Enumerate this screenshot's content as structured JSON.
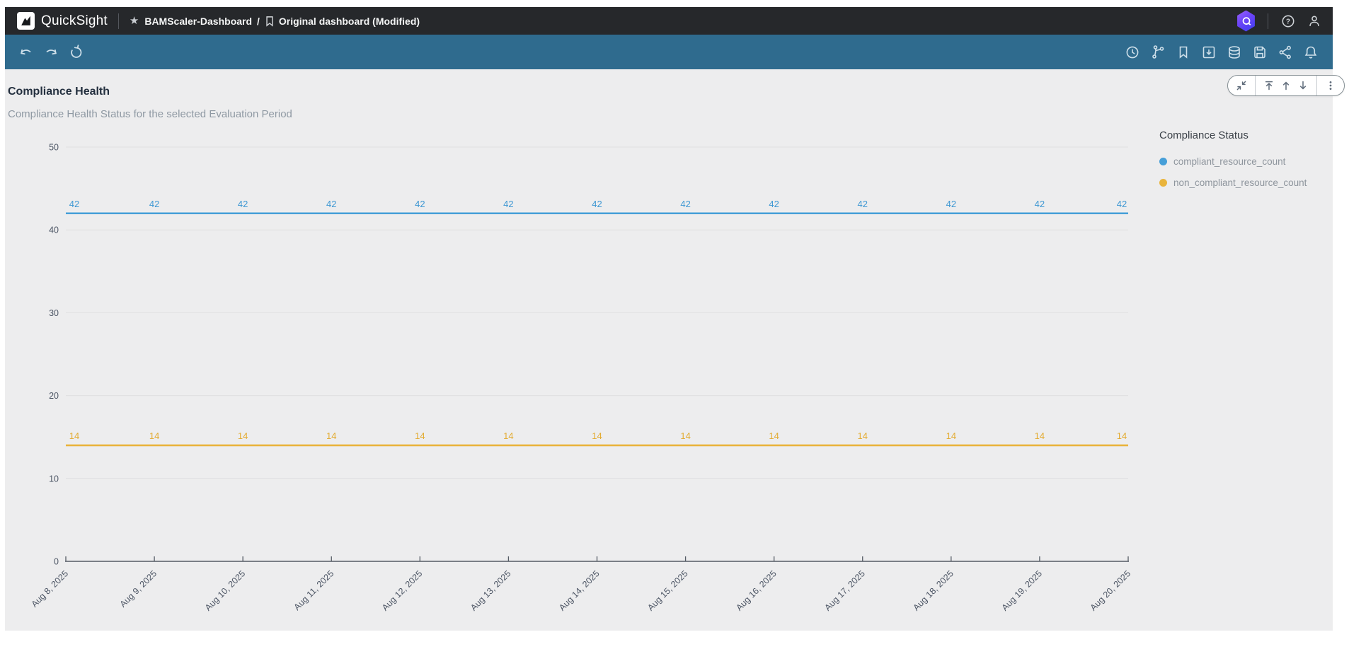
{
  "topbar": {
    "app_name": "QuickSight",
    "breadcrumb": {
      "dashboard": "BAMScaler-Dashboard",
      "separator": "/",
      "page": "Original dashboard (Modified)"
    }
  },
  "widget": {
    "title": "Compliance Health",
    "subtitle": "Compliance Health Status for the selected Evaluation Period"
  },
  "legend": {
    "title": "Compliance Status"
  },
  "colors": {
    "topbar_bg": "#26282b",
    "toolbar_bg": "#2f6b8e",
    "content_bg": "#ededee",
    "grid_line": "#dfdfe0",
    "axis_line": "#545b64",
    "series_blue": "#469fd8",
    "series_yellow": "#e9b43c"
  },
  "chart_data": {
    "type": "line",
    "title": "Compliance Health",
    "xlabel": "",
    "ylabel": "",
    "ylim": [
      0,
      50
    ],
    "y_ticks": [
      0,
      10,
      20,
      30,
      40,
      50
    ],
    "grid": true,
    "data_labels": true,
    "legend_position": "right",
    "legend_title": "Compliance Status",
    "categories": [
      "Aug 8, 2025",
      "Aug 9, 2025",
      "Aug 10, 2025",
      "Aug 11, 2025",
      "Aug 12, 2025",
      "Aug 13, 2025",
      "Aug 14, 2025",
      "Aug 15, 2025",
      "Aug 16, 2025",
      "Aug 17, 2025",
      "Aug 18, 2025",
      "Aug 19, 2025",
      "Aug 20, 2025"
    ],
    "series": [
      {
        "name": "compliant_resource_count",
        "color": "#469fd8",
        "label_color": "#3f98d3",
        "values": [
          42,
          42,
          42,
          42,
          42,
          42,
          42,
          42,
          42,
          42,
          42,
          42,
          42
        ]
      },
      {
        "name": "non_compliant_resource_count",
        "color": "#e9b43c",
        "label_color": "#e3ac33",
        "values": [
          14,
          14,
          14,
          14,
          14,
          14,
          14,
          14,
          14,
          14,
          14,
          14,
          14
        ]
      }
    ]
  }
}
